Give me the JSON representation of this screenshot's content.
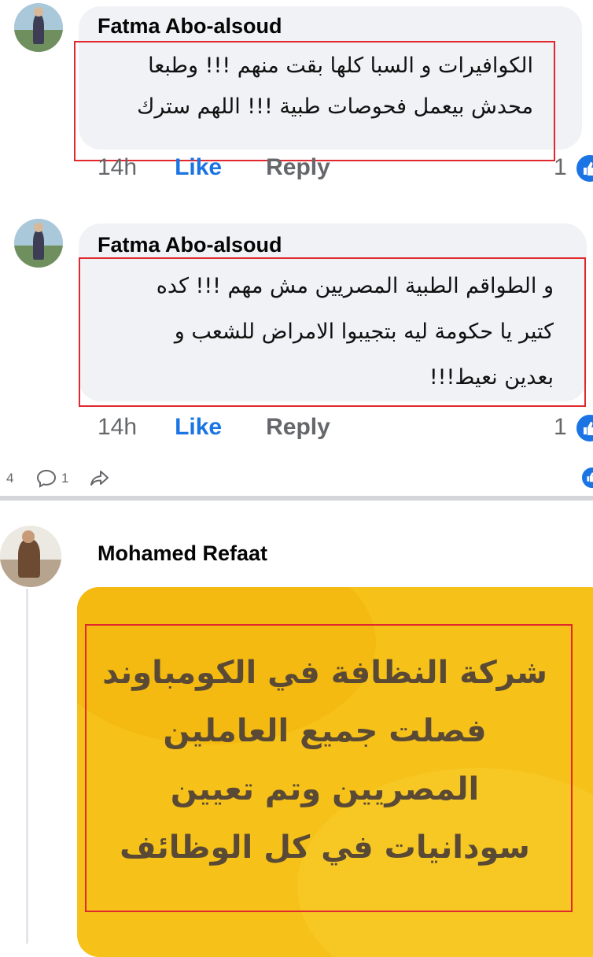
{
  "comments": [
    {
      "author": "Fatma Abo-alsoud",
      "lines": [
        "الكوافيرات و السبا كلها بقت منهم !!! وطبعا",
        "محدش بيعمل فحوصات طبية !!! اللهم سترك"
      ],
      "time": "14h",
      "like_label": "Like",
      "reply_label": "Reply",
      "reaction_count": "1"
    },
    {
      "author": "Fatma Abo-alsoud",
      "lines": [
        "و الطواقم الطبية المصريين مش مهم !!!  كده",
        "كتير يا حكومة ليه بتجيبوا الامراض للشعب و",
        "بعدين نعيط!!!"
      ],
      "time": "14h",
      "like_label": "Like",
      "reply_label": "Reply",
      "reaction_count": "1"
    }
  ],
  "post_bar": {
    "left_count": "4",
    "comment_count": "1"
  },
  "second_comment": {
    "author": "Mohamed Refaat",
    "image_lines": [
      "شركة النظافة في الكومباوند",
      "فصلت جميع العاملين",
      "المصريين وتم تعيين",
      "سودانيات في كل الوظائف"
    ]
  },
  "colors": {
    "like_blue": "#1b74e4",
    "highlight_red": "#e0282e",
    "bubble_gray": "#f0f2f5",
    "image_yellow": "#f6c21a"
  },
  "icons": [
    "comment-bubble-icon",
    "share-arrow-icon",
    "like-thumb-icon"
  ]
}
